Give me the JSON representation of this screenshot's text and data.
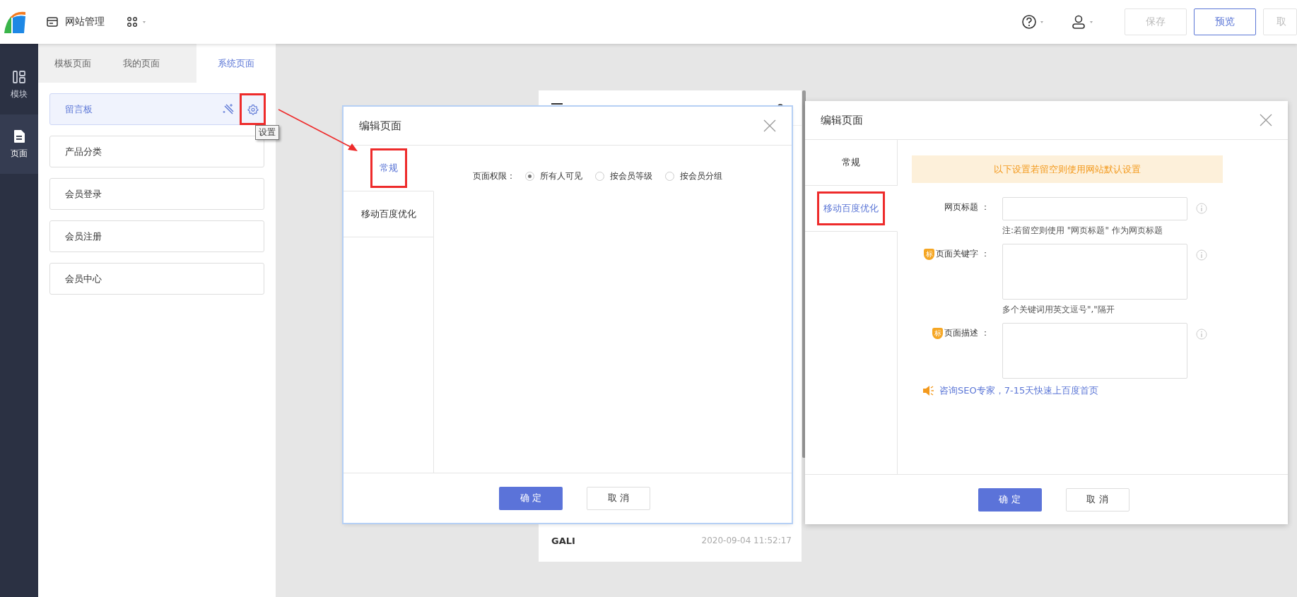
{
  "topbar": {
    "site_menu": "网站管理",
    "buttons": [
      {
        "label": "保存",
        "disabled": true
      },
      {
        "label": "预览",
        "disabled": false
      },
      {
        "label": "取",
        "disabled": true
      }
    ]
  },
  "sidebar": {
    "items": [
      {
        "label": "模块",
        "selected": false
      },
      {
        "label": "页面",
        "selected": true
      }
    ]
  },
  "page_tabs": [
    {
      "label": "模板页面",
      "selected": false
    },
    {
      "label": "我的页面",
      "selected": false
    },
    {
      "label": "系统页面",
      "selected": true
    }
  ],
  "pages": [
    {
      "label": "留言板",
      "selected": true
    },
    {
      "label": "产品分类",
      "selected": false
    },
    {
      "label": "会员登录",
      "selected": false
    },
    {
      "label": "会员注册",
      "selected": false
    },
    {
      "label": "会员中心",
      "selected": false
    }
  ],
  "settings_tooltip": "设置",
  "preview": {
    "author": "GALI",
    "time": "2020-09-04 11:52:17"
  },
  "dialogs": [
    {
      "kind": "general",
      "title": "编辑页面",
      "tabs": [
        {
          "label": "常规",
          "selected": true,
          "highlighted": true
        },
        {
          "label": "移动百度优化",
          "selected": false,
          "highlighted": false
        }
      ],
      "permission": {
        "label": "页面权限：",
        "options": [
          {
            "label": "所有人可见",
            "selected": true
          },
          {
            "label": "按会员等级",
            "selected": false
          },
          {
            "label": "按会员分组",
            "selected": false
          }
        ]
      },
      "ok": "确 定",
      "cancel": "取 消"
    },
    {
      "kind": "seo",
      "title": "编辑页面",
      "tabs": [
        {
          "label": "常规",
          "selected": false,
          "highlighted": false
        },
        {
          "label": "移动百度优化",
          "selected": true,
          "highlighted": true
        }
      ],
      "notice": "以下设置若留空则使用网站默认设置",
      "fields": [
        {
          "kind": "input",
          "label": "网页标题 ：",
          "note": "注:若留空则使用 \"网页标题\" 作为网页标题"
        },
        {
          "kind": "textarea",
          "badge": "标",
          "label": "页面关键字 ：",
          "note": "多个关键词用英文逗号\",\"隔开"
        },
        {
          "kind": "textarea",
          "badge": "标",
          "label": "页面描述 ："
        }
      ],
      "link": "咨询SEO专家，7-15天快速上百度首页",
      "ok": "确 定",
      "cancel": "取 消"
    }
  ]
}
